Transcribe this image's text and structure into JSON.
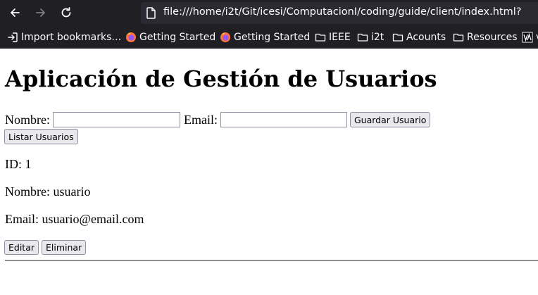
{
  "browser": {
    "url": "file:///home/i2t/Git/icesi/ComputacionI/coding/guide/client/index.html?",
    "nav": {
      "back_icon": "arrow-left-icon",
      "forward_icon": "arrow-right-icon",
      "reload_icon": "reload-icon"
    },
    "bookmarks": [
      {
        "label": "Import bookmarks…",
        "icon": "import-icon"
      },
      {
        "label": "Getting Started",
        "icon": "firefox-icon"
      },
      {
        "label": "Getting Started",
        "icon": "firefox-icon"
      },
      {
        "label": "IEEE",
        "icon": "folder-icon"
      },
      {
        "label": "i2t",
        "icon": "folder-icon"
      },
      {
        "label": "Acounts",
        "icon": "folder-icon"
      },
      {
        "label": "Resources",
        "icon": "folder-icon"
      },
      {
        "label": "v",
        "icon": "site-icon"
      }
    ],
    "colors": {
      "chrome": "#1f1f24",
      "urlbar": "#2b2a33",
      "text": "#fbfbfe"
    }
  },
  "page": {
    "title": "Aplicación de Gestión de Usuarios",
    "form": {
      "name_label": "Nombre:",
      "name_value": "",
      "email_label": "Email:",
      "email_value": "",
      "save_label": "Guardar Usuario"
    },
    "list_label": "Listar Usuarios",
    "user": {
      "id_text": "ID: 1",
      "name_text": "Nombre: usuario",
      "email_text": "Email: usuario@email.com"
    },
    "actions": {
      "edit_label": "Editar",
      "delete_label": "Eliminar"
    }
  }
}
